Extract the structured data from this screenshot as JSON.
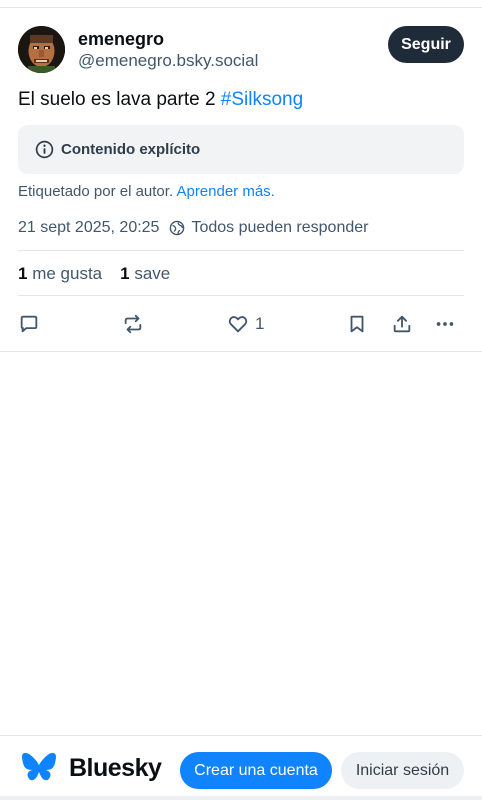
{
  "post": {
    "author": {
      "display_name": "emenegro",
      "handle": "@emenegro.bsky.social",
      "avatar_icon": "doom-face-avatar"
    },
    "follow_label": "Seguir",
    "text": "El suelo es lava parte 2 ",
    "hashtag": "#Silksong",
    "content_label": "Contenido explícito",
    "labeled_by_text": "Etiquetado por el autor.",
    "learn_more": "Aprender más.",
    "timestamp": "21 sept 2025, 20:25",
    "reply_setting": "Todos pueden responder",
    "stats": {
      "likes_count": "1",
      "likes_label": "me gusta",
      "saves_count": "1",
      "saves_label": "save"
    },
    "actions": {
      "reply_icon": "comment-icon",
      "repost_icon": "repost-icon",
      "like_icon": "heart-icon",
      "like_count": "1",
      "bookmark_icon": "bookmark-icon",
      "share_icon": "share-icon",
      "more_icon": "more-icon"
    }
  },
  "footer": {
    "brand": "Bluesky",
    "create_account": "Crear una cuenta",
    "sign_in": "Iniciar sesión"
  },
  "colors": {
    "accent": "#1083fe",
    "follow_bg": "#1f2b38",
    "muted_text": "#42576c"
  }
}
